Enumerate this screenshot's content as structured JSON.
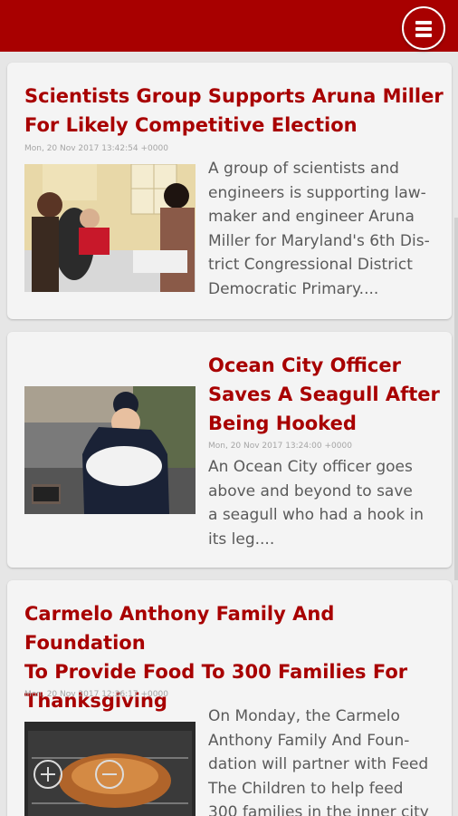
{
  "topbar": {
    "menu_icon": "hamburger-menu-icon",
    "brand_color": "#a80000"
  },
  "articles": [
    {
      "title_lines": [
        "Scientists Group Supports Aruna Miller",
        "For Likely Competitive Election"
      ],
      "date": "Mon, 20 Nov 2017 13:42:54 +0000",
      "summary_lines": [
        "A group of scientists and",
        "engineers is supporting law-",
        "maker and engineer Aruna",
        "Miller for Maryland's 6th Dis-",
        "trict Congressional District",
        "Democratic Primary...."
      ]
    },
    {
      "title_lines": [
        "Ocean City Officer",
        "Saves A Seagull After",
        "Being Hooked"
      ],
      "date": "Mon, 20 Nov 2017 13:24:00 +0000",
      "summary_lines": [
        "An Ocean City officer goes",
        "above and beyond to save",
        "a seagull who had a hook in",
        "its leg...."
      ]
    },
    {
      "title_lines": [
        "Carmelo Anthony Family And Foundation",
        "To Provide Food To 300 Families For",
        "Thanksgiving"
      ],
      "date": "Mon, 20 Nov 2017 12:36:17 +0000",
      "summary_lines": [
        "On Monday, the Carmelo",
        "Anthony Family And Foun-",
        "dation will partner with Feed",
        "The Children to help feed",
        "300 families in the inner city"
      ]
    }
  ]
}
